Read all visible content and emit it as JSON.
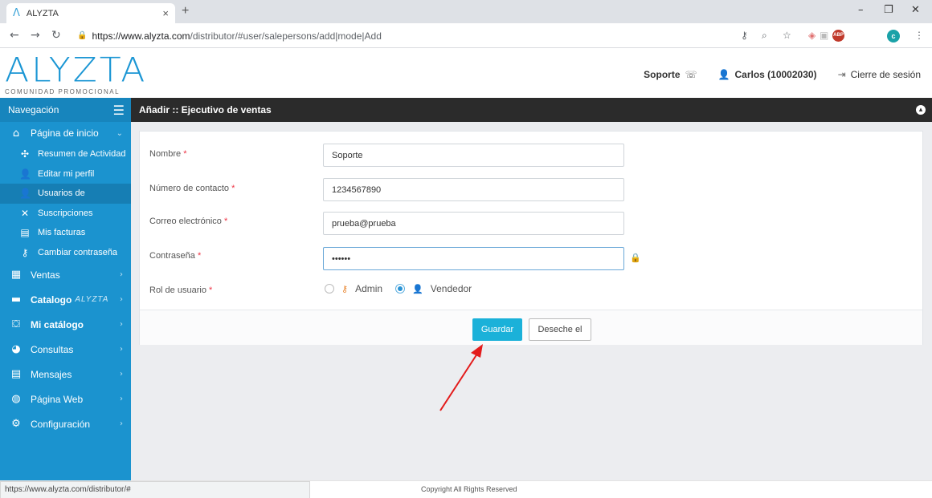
{
  "browser": {
    "tab_title": "ALYZTA",
    "url_host": "https://www.alyzta.com",
    "url_path": "/distributor/#user/salepersons/add|mode|Add",
    "profile_initial": "c",
    "status_url": "https://www.alyzta.com/distributor/#"
  },
  "header": {
    "logo_text": "ALYZTA",
    "logo_sub": "COMUNIDAD PROMOCIONAL",
    "support": "Soporte",
    "user": "Carlos (10002030)",
    "logout": "Cierre de sesión"
  },
  "sidebar": {
    "title": "Navegación",
    "home": "Página de inicio",
    "sub_items": [
      {
        "label": "Resumen de Actividad",
        "icon": "pinwheel-icon"
      },
      {
        "label": "Editar mi perfil",
        "icon": "user-icon"
      },
      {
        "label": "Usuarios de",
        "icon": "user-icon"
      },
      {
        "label": "Suscripciones",
        "icon": "puzzle-icon"
      },
      {
        "label": "Mis facturas",
        "icon": "invoice-icon"
      },
      {
        "label": "Cambiar contraseña",
        "icon": "key-icon"
      }
    ],
    "items": [
      {
        "label": "Ventas",
        "icon": "sales-icon"
      },
      {
        "label": "Catalogo",
        "brand": "ALYZTA",
        "icon": "catalog-icon"
      },
      {
        "label": "Mi catálogo",
        "icon": "star-box-icon"
      },
      {
        "label": "Consultas",
        "icon": "pie-icon"
      },
      {
        "label": "Mensajes",
        "icon": "message-icon"
      },
      {
        "label": "Página Web",
        "icon": "globe-icon"
      },
      {
        "label": "Configuración",
        "icon": "gear-icon"
      }
    ]
  },
  "page": {
    "title": "Añadir :: Ejecutivo de ventas"
  },
  "form": {
    "required_mark": "*",
    "name_label": "Nombre",
    "name_value": "Soporte",
    "phone_label": "Número de contacto",
    "phone_value": "1234567890",
    "email_label": "Correo electrónico",
    "email_value": "prueba@prueba",
    "password_label": "Contraseña",
    "password_value": "••••••",
    "role_label": "Rol de usuario",
    "role_admin": "Admin",
    "role_vendor": "Vendedor",
    "save": "Guardar",
    "discard": "Deseche el"
  },
  "footer": {
    "copyright": "Copyright All Rights Reserved"
  },
  "colors": {
    "brand_blue": "#1b93cf",
    "save_button": "#1bb1d9",
    "arrow": "#e31b1b"
  }
}
